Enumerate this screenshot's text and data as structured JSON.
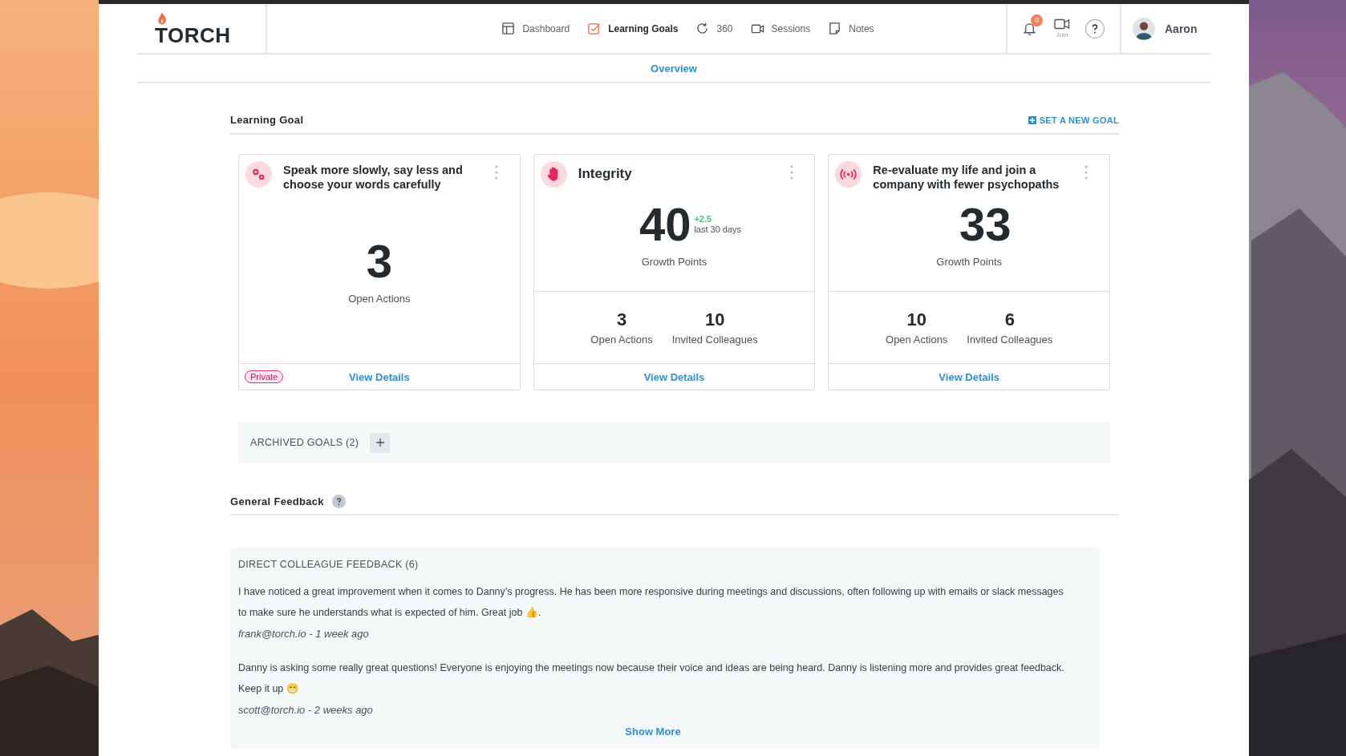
{
  "logo": {
    "text": "TORCH"
  },
  "nav": [
    {
      "label": "Dashboard",
      "selected": false
    },
    {
      "label": "Learning Goals",
      "selected": true
    },
    {
      "label": "360",
      "selected": false
    },
    {
      "label": "Sessions",
      "selected": false
    },
    {
      "label": "Notes",
      "selected": false
    }
  ],
  "notifications": {
    "count": "0"
  },
  "join": {
    "label": "Join"
  },
  "user": {
    "name": "Aaron"
  },
  "subnav": {
    "label": "Overview"
  },
  "learning_goal": {
    "title": "Learning Goal",
    "action": "SET A NEW GOAL",
    "goals": [
      {
        "kind": "actions",
        "title": "Speak more slowly, say less and choose your words carefully",
        "value": "3",
        "value_label": "Open Actions",
        "badge": "Private",
        "link": "View Details"
      },
      {
        "kind": "growth",
        "title": "Integrity",
        "value": "40",
        "change": "+2.5",
        "change_period": "last 30 days",
        "value_label": "Growth Points",
        "stats": [
          {
            "value": "3",
            "label": "Open Actions"
          },
          {
            "value": "10",
            "label": "Invited Colleagues"
          }
        ],
        "link": "View Details"
      },
      {
        "kind": "growth",
        "title": "Re-evaluate my life and join a company with fewer psychopaths",
        "value": "33",
        "value_label": "Growth Points",
        "stats": [
          {
            "value": "10",
            "label": "Open Actions"
          },
          {
            "value": "6",
            "label": "Invited Colleagues"
          }
        ],
        "link": "View Details"
      }
    ]
  },
  "archived": {
    "label": "ARCHIVED GOALS (2)",
    "expanded": false
  },
  "feedback": {
    "title": "General Feedback",
    "group_title": "DIRECT COLLEAGUE FEEDBACK (6)",
    "items": [
      {
        "text": "I have noticed a great improvement when it comes to Danny’s progress. He has been more responsive during meetings and discussions, often following up with emails or slack messages to make sure he understands what is expected of him. Great job 👍.",
        "author": "frank@torch.io - 1 week ago"
      },
      {
        "text": "Danny is asking some really great questions! Everyone is enjoying the meetings now because their voice and ideas are being heard. Danny is listening more and provides great feedback. Keep it up 😁",
        "author": "scott@torch.io - 2 weeks ago"
      }
    ],
    "show_more": "Show More"
  }
}
